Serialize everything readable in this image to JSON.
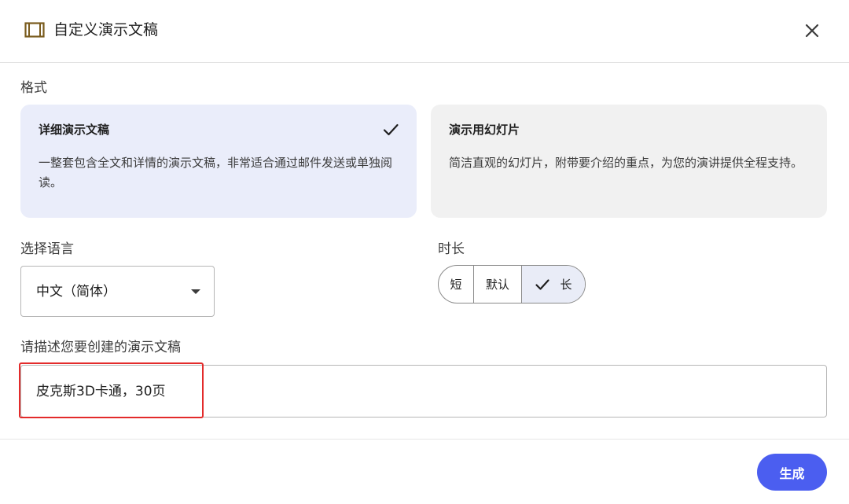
{
  "header": {
    "title": "自定义演示文稿",
    "icon": "slides-frame-icon",
    "close_icon": "close-icon"
  },
  "format": {
    "label": "格式",
    "options": [
      {
        "title": "详细演示文稿",
        "desc": "一整套包含全文和详情的演示文稿，非常适合通过邮件发送或单独阅读。",
        "selected": true
      },
      {
        "title": "演示用幻灯片",
        "desc": "简洁直观的幻灯片，附带要介绍的重点，为您的演讲提供全程支持。",
        "selected": false
      }
    ]
  },
  "language": {
    "label": "选择语言",
    "value": "中文（简体）"
  },
  "duration": {
    "label": "时长",
    "options": [
      "短",
      "默认",
      "长"
    ],
    "selected": "长"
  },
  "prompt": {
    "label": "请描述您要创建的演示文稿",
    "value": "皮克斯3D卡通，30页"
  },
  "actions": {
    "generate_label": "生成"
  },
  "colors": {
    "accent": "#4b5ef0",
    "selected_card": "#eaedfa",
    "annotation_border": "#e32b2b"
  }
}
